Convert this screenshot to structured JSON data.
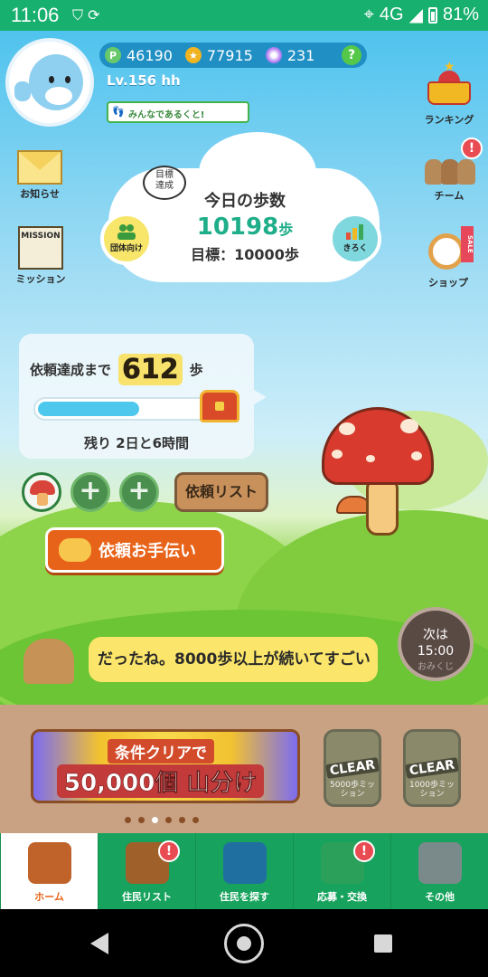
{
  "status_bar": {
    "time": "11:06",
    "network": "4G",
    "battery": "81%",
    "left_icons": [
      "shield-icon",
      "sync-icon"
    ],
    "right_icons": [
      "location-icon",
      "data-icon",
      "signal-icon",
      "battery-icon"
    ]
  },
  "header": {
    "points": "46190",
    "coins": "77915",
    "gems": "231",
    "help_label": "?",
    "points_label": "P",
    "level": "Lv.156 hh",
    "walk_banner": "みんなであるくと!"
  },
  "side_menu": {
    "news": "お知らせ",
    "mission": "ミッション",
    "mission_card_text": "MISSION",
    "ranking": "ランキング",
    "team": "チーム",
    "shop": "ショップ",
    "shop_sale": "SALE",
    "badge": "!"
  },
  "steps": {
    "goal_bubble": "目標\n達成",
    "title": "今日の歩数",
    "count": "10198",
    "unit": "歩",
    "goal": "目標：10000歩",
    "group_label": "団体向け",
    "record_label": "きろく"
  },
  "quest": {
    "until_label": "依頼達成まで",
    "remaining_steps": "612",
    "steps_unit": "歩",
    "progress": 0.55,
    "time_left": "残り 2日と6時間",
    "add_label": "+",
    "list_button": "依頼リスト",
    "help_button": "依頼お手伝い"
  },
  "message": {
    "text": "だったね。8000歩以上が続いてすごい",
    "next_label": "次は",
    "next_time": "15:00",
    "omikuji_label": "おみくじ"
  },
  "campaign": {
    "line1": "条件クリアで",
    "line2": "50,000個 山分け",
    "cards": [
      {
        "status": "CLEAR",
        "name": "5000歩ミッション"
      },
      {
        "status": "CLEAR",
        "name": "1000歩ミッション"
      }
    ],
    "dots": 6,
    "active_dot": 2
  },
  "bottom_nav": [
    {
      "label": "ホーム",
      "icon": "house-icon",
      "active": true,
      "badge": false
    },
    {
      "label": "住民リスト",
      "icon": "resident-list-icon",
      "active": false,
      "badge": true
    },
    {
      "label": "住民を探す",
      "icon": "binoculars-icon",
      "active": false,
      "badge": false
    },
    {
      "label": "応募・交換",
      "icon": "exchange-icon",
      "active": false,
      "badge": true
    },
    {
      "label": "その他",
      "icon": "gear-icon",
      "active": false,
      "badge": false
    }
  ],
  "colors": {
    "brand_green": "#17a35d",
    "accent_orange": "#e8631a",
    "steps_teal": "#1fae8a",
    "progress_blue": "#4fc8ee",
    "badge_red": "#e94b52"
  }
}
